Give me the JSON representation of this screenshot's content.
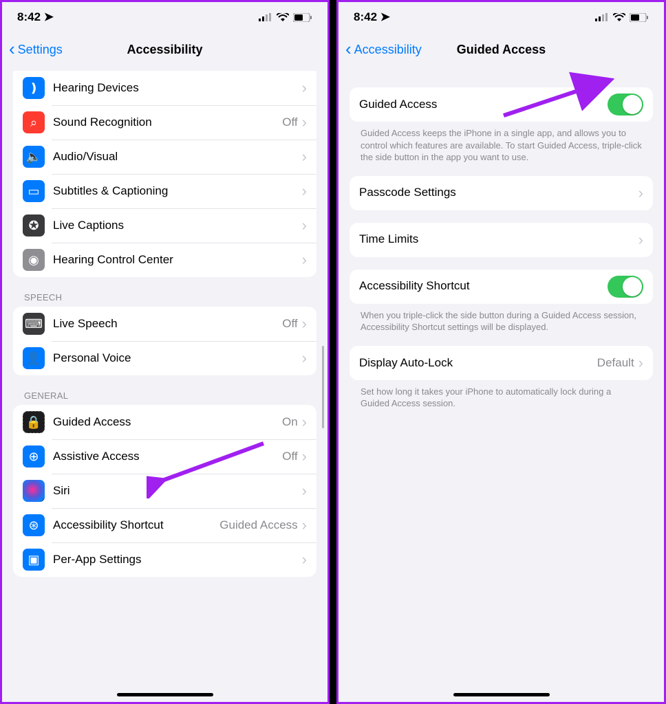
{
  "status": {
    "time": "8:42",
    "location_glyph": "➤",
    "signal_glyph": "▮▮▯▯",
    "wifi_glyph": "✶",
    "battery_glyph": "▢"
  },
  "left": {
    "nav": {
      "back": "Settings",
      "title": "Accessibility"
    },
    "hearing_group": [
      {
        "key": "hearing-devices",
        "label": "Hearing Devices",
        "value": "",
        "icon_cls": "ic-blue",
        "glyph": "❫"
      },
      {
        "key": "sound-recognition",
        "label": "Sound Recognition",
        "value": "Off",
        "icon_cls": "ic-red",
        "glyph": "⌕"
      },
      {
        "key": "audio-visual",
        "label": "Audio/Visual",
        "value": "",
        "icon_cls": "ic-blue",
        "glyph": "🔈"
      },
      {
        "key": "subtitles",
        "label": "Subtitles & Captioning",
        "value": "",
        "icon_cls": "ic-blue",
        "glyph": "▭"
      },
      {
        "key": "live-captions",
        "label": "Live Captions",
        "value": "",
        "icon_cls": "ic-dgray",
        "glyph": "✪"
      },
      {
        "key": "hearing-control",
        "label": "Hearing Control Center",
        "value": "",
        "icon_cls": "ic-gray",
        "glyph": "◉"
      }
    ],
    "speech_header": "Speech",
    "speech_group": [
      {
        "key": "live-speech",
        "label": "Live Speech",
        "value": "Off",
        "icon_cls": "ic-dgray",
        "glyph": "⌨"
      },
      {
        "key": "personal-voice",
        "label": "Personal Voice",
        "value": "",
        "icon_cls": "ic-blue",
        "glyph": "👤"
      }
    ],
    "general_header": "General",
    "general_group": [
      {
        "key": "guided-access",
        "label": "Guided Access",
        "value": "On",
        "icon_cls": "ic-black",
        "glyph": "🔒"
      },
      {
        "key": "assistive-access",
        "label": "Assistive Access",
        "value": "Off",
        "icon_cls": "ic-blue",
        "glyph": "⊕"
      },
      {
        "key": "siri",
        "label": "Siri",
        "value": "",
        "icon_cls": "ic-siri",
        "glyph": ""
      },
      {
        "key": "a11y-shortcut",
        "label": "Accessibility Shortcut",
        "value": "Guided Access",
        "icon_cls": "ic-blue",
        "glyph": "⊛"
      },
      {
        "key": "per-app",
        "label": "Per-App Settings",
        "value": "",
        "icon_cls": "ic-blue",
        "glyph": "▣"
      }
    ]
  },
  "right": {
    "nav": {
      "back": "Accessibility",
      "title": "Guided Access"
    },
    "toggle_row": {
      "label": "Guided Access",
      "on": true
    },
    "toggle_footer": "Guided Access keeps the iPhone in a single app, and allows you to control which features are available. To start Guided Access, triple-click the side button in the app you want to use.",
    "passcode_row": {
      "label": "Passcode Settings"
    },
    "timelimits_row": {
      "label": "Time Limits"
    },
    "shortcut_row": {
      "label": "Accessibility Shortcut",
      "on": true
    },
    "shortcut_footer": "When you triple-click the side button during a Guided Access session, Accessibility Shortcut settings will be displayed.",
    "autolock_row": {
      "label": "Display Auto-Lock",
      "value": "Default"
    },
    "autolock_footer": "Set how long it takes your iPhone to automatically lock during a Guided Access session."
  }
}
